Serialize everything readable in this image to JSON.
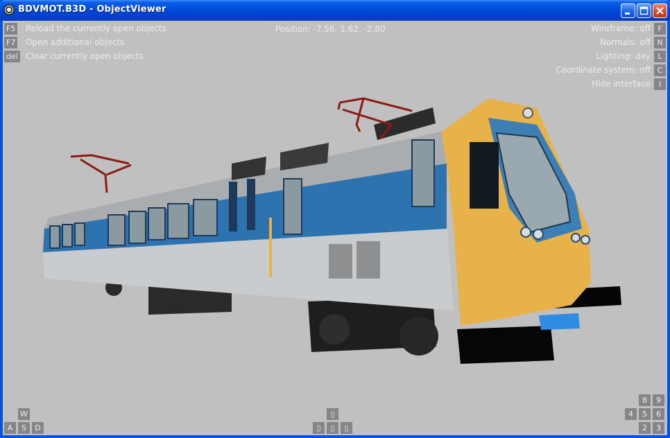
{
  "window": {
    "title": "BDVMOT.B3D - ObjectViewer",
    "controls": {
      "minimize": "minimize-icon",
      "maximize": "maximize-icon",
      "close": "close-icon"
    }
  },
  "commands_left": [
    {
      "key": "F5",
      "label": "Reload the currently open objects"
    },
    {
      "key": "F7",
      "label": "Open additional objects"
    },
    {
      "key": "del",
      "label": "Clear currently open objects"
    }
  ],
  "position_readout": "Position: -7.56, 1.62, -2.80",
  "toggles_right": [
    {
      "label": "Wireframe: off",
      "key": "F"
    },
    {
      "label": "Normals: off",
      "key": "N"
    },
    {
      "label": "Lighting: day",
      "key": "L"
    },
    {
      "label": "Coordinate system: off",
      "key": "C"
    },
    {
      "label": "Hide interface",
      "key": "I"
    }
  ],
  "move_keys": {
    "up": "W",
    "left": "A",
    "down": "S",
    "right": "D"
  },
  "arrow_keys": {
    "up": "▯",
    "left": "▯",
    "mid": "▯",
    "right": "▯"
  },
  "numpad_keys": {
    "k8": "8",
    "k9": "9",
    "k4": "4",
    "k5": "5",
    "k6": "6",
    "k2": "2",
    "k3": "3"
  },
  "colors": {
    "viewport_bg": "#c0c0c0",
    "key_bg": "#858585",
    "train_blue": "#2d73b0",
    "train_yellow": "#e8b24a",
    "train_silver": "#c9ccce",
    "pantograph": "#8b1a12"
  }
}
